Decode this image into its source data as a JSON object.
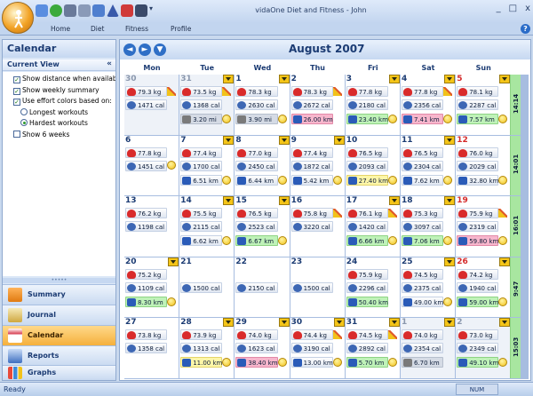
{
  "window": {
    "title": "vidaOne Diet and Fitness - John",
    "controls": [
      "_",
      "□",
      "x"
    ]
  },
  "ribbon": {
    "tabs": [
      "Home",
      "Diet",
      "Fitness",
      "Profile"
    ],
    "help": "?"
  },
  "left_panel": {
    "title": "Calendar",
    "current_view": {
      "header": "Current View",
      "options": [
        {
          "type": "check",
          "checked": true,
          "label": "Show distance when available"
        },
        {
          "type": "check",
          "checked": true,
          "label": "Show weekly summary"
        },
        {
          "type": "check",
          "checked": true,
          "label": "Use effort colors based on:"
        },
        {
          "type": "radio",
          "checked": false,
          "label": "Longest workouts"
        },
        {
          "type": "radio",
          "checked": true,
          "label": "Hardest workouts"
        },
        {
          "type": "check",
          "checked": false,
          "label": "Show 6 weeks"
        }
      ]
    },
    "nav": [
      "Summary",
      "Journal",
      "Calendar",
      "Reports",
      "Graphs"
    ],
    "active_nav": "Calendar",
    "nav_more": "»"
  },
  "calendar": {
    "month_title": "August 2007",
    "nav": {
      "prev": "◄",
      "next": "►",
      "down": "▼"
    },
    "days_of_week": [
      "Mon",
      "Tue",
      "Wed",
      "Thu",
      "Fri",
      "Sat",
      "Sun"
    ],
    "weekly_totals": [
      "14:14",
      "14:01",
      "16:01",
      "9:47",
      "15:03"
    ],
    "weeks": [
      [
        {
          "d": "30",
          "other": true,
          "w": "79.3 kg",
          "c": "1471 cal",
          "pencil": true
        },
        {
          "d": "31",
          "other": true,
          "w": "73.5 kg",
          "c": "1368 cal",
          "x": "3.20 mi",
          "xc": "grey",
          "flag": true,
          "face": true,
          "pencil": true
        },
        {
          "d": "1",
          "w": "78.3 kg",
          "c": "2630 cal",
          "x": "3.90 mi",
          "xc": "grey",
          "flag": true,
          "face": true
        },
        {
          "d": "2",
          "w": "78.3 kg",
          "c": "2672 cal",
          "x": "26.00 km",
          "xc": "pink",
          "pencil": true
        },
        {
          "d": "3",
          "w": "77.8 kg",
          "c": "2180 cal",
          "x": "23.40 km",
          "xc": "green",
          "flag": true,
          "face": true
        },
        {
          "d": "4",
          "w": "77.8 kg",
          "c": "2356 cal",
          "x": "7.41 km",
          "xc": "pink",
          "flag": true,
          "face": true,
          "pencil": true
        },
        {
          "d": "5",
          "sun": true,
          "w": "78.1 kg",
          "c": "2287 cal",
          "x": "7.57 km",
          "xc": "green",
          "flag": true,
          "face": true
        }
      ],
      [
        {
          "d": "6",
          "w": "77.8 kg",
          "c": "1451 cal",
          "face": true
        },
        {
          "d": "7",
          "w": "77.4 kg",
          "c": "1700 cal",
          "x": "6.51 km",
          "xc": "blue",
          "flag": true,
          "face": true
        },
        {
          "d": "8",
          "w": "77.0 kg",
          "c": "2450 cal",
          "x": "6.44 km",
          "xc": "blue",
          "flag": true,
          "face": true
        },
        {
          "d": "9",
          "w": "77.4 kg",
          "c": "1872 cal",
          "x": "5.42 km",
          "xc": "blue",
          "flag": true,
          "face": true
        },
        {
          "d": "10",
          "w": "76.5 kg",
          "c": "2093 cal",
          "x": "27.40 km",
          "xc": "yellow",
          "face": true
        },
        {
          "d": "11",
          "w": "76.5 kg",
          "c": "2304 cal",
          "x": "7.62 km",
          "xc": "blue",
          "flag": true,
          "face": true
        },
        {
          "d": "12",
          "sun": true,
          "w": "76.0 kg",
          "c": "2029 cal",
          "x": "32.80 km",
          "xc": "blue",
          "face": true
        }
      ],
      [
        {
          "d": "13",
          "w": "76.2 kg",
          "c": "1198 cal"
        },
        {
          "d": "14",
          "w": "75.5 kg",
          "c": "2115 cal",
          "x": "6.62 km",
          "xc": "blue",
          "flag": true,
          "face": true
        },
        {
          "d": "15",
          "w": "76.5 kg",
          "c": "2523 cal",
          "x": "6.67 km",
          "xc": "green",
          "flag": true,
          "face": true
        },
        {
          "d": "16",
          "w": "75.8 kg",
          "c": "3220 cal",
          "pencil": true
        },
        {
          "d": "17",
          "w": "76.1 kg",
          "c": "1420 cal",
          "x": "6.66 km",
          "xc": "green",
          "flag": true,
          "face": true,
          "pencil": true
        },
        {
          "d": "18",
          "w": "75.3 kg",
          "c": "3097 cal",
          "x": "7.06 km",
          "xc": "green",
          "flag": true,
          "face": true
        },
        {
          "d": "19",
          "sun": true,
          "w": "75.9 kg",
          "c": "2319 cal",
          "x": "59.80 km",
          "xc": "pink",
          "face": true,
          "pencil": true
        }
      ],
      [
        {
          "d": "20",
          "w": "75.2 kg",
          "c": "1109 cal",
          "x": "8.30 km",
          "xc": "green",
          "flag": true,
          "face": true
        },
        {
          "d": "21",
          "c": "1500 cal"
        },
        {
          "d": "22",
          "c": "2150 cal"
        },
        {
          "d": "23",
          "c": "1500 cal"
        },
        {
          "d": "24",
          "w": "75.9 kg",
          "c": "2296 cal",
          "x": "50.40 km",
          "xc": "green"
        },
        {
          "d": "25",
          "w": "74.5 kg",
          "c": "2375 cal",
          "x": "49.00 km",
          "xc": "blue",
          "flag": true,
          "face": true
        },
        {
          "d": "26",
          "sun": true,
          "w": "74.2 kg",
          "c": "1940 cal",
          "x": "59.00 km",
          "xc": "green",
          "flag": true,
          "face": true
        }
      ],
      [
        {
          "d": "27",
          "w": "73.8 kg",
          "c": "1358 cal"
        },
        {
          "d": "28",
          "w": "73.9 kg",
          "c": "1313 cal",
          "x": "11.00 km",
          "xc": "yellow",
          "flag": true,
          "face": true
        },
        {
          "d": "29",
          "w": "74.0 kg",
          "c": "1623 cal",
          "x": "38.40 km",
          "xc": "pink",
          "flag": true,
          "face": true
        },
        {
          "d": "30",
          "w": "74.4 kg",
          "c": "3190 cal",
          "x": "13.00 km",
          "xc": "blue",
          "flag": true,
          "face": true,
          "pencil": true
        },
        {
          "d": "31",
          "w": "74.5 kg",
          "c": "2892 cal",
          "x": "5.70 km",
          "xc": "green",
          "flag": true,
          "face": true,
          "pencil": true
        },
        {
          "d": "1",
          "other": true,
          "w": "74.0 kg",
          "c": "2354 cal",
          "x": "6.70 km",
          "xc": "grey",
          "flag": true
        },
        {
          "d": "2",
          "other": true,
          "w": "73.0 kg",
          "c": "2349 cal",
          "x": "49.10 km",
          "xc": "green",
          "flag": true,
          "face": true
        }
      ]
    ]
  },
  "status": {
    "text": "Ready",
    "indicator": "NUM"
  }
}
